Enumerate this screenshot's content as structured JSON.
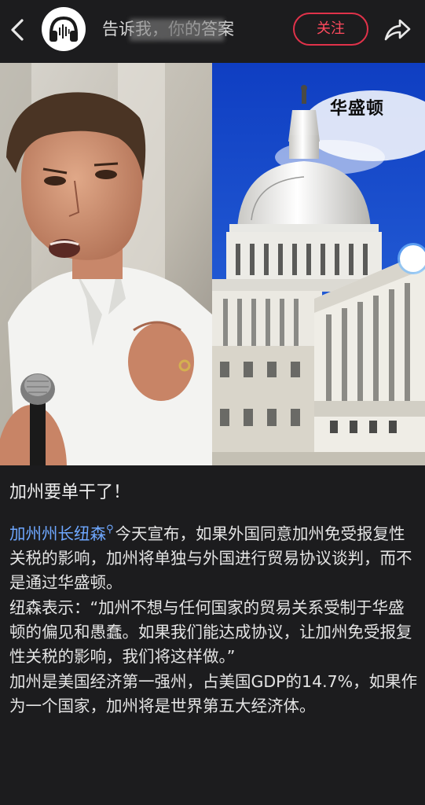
{
  "header": {
    "account_name": "告诉我，你的答案",
    "follow_label": "关注"
  },
  "hero": {
    "caption": "华盛顿"
  },
  "article": {
    "headline": "加州要单干了！",
    "p1_link": "加州州长纽森",
    "p1_rest": "今天宣布，如果外国同意加州免受报复性关税的影响，加州将单独与外国进行贸易协议谈判，而不是通过华盛顿。",
    "p2": "纽森表示：“加州不想与任何国家的贸易关系受制于华盛顿的偏见和愚蠢。如果我们能达成协议，让加州免受报复性关税的影响，我们将这样做。”",
    "p3": "加州是美国经济第一强州，占美国GDP的14.7%，如果作为一个国家，加州将是世界第五大经济体。"
  }
}
